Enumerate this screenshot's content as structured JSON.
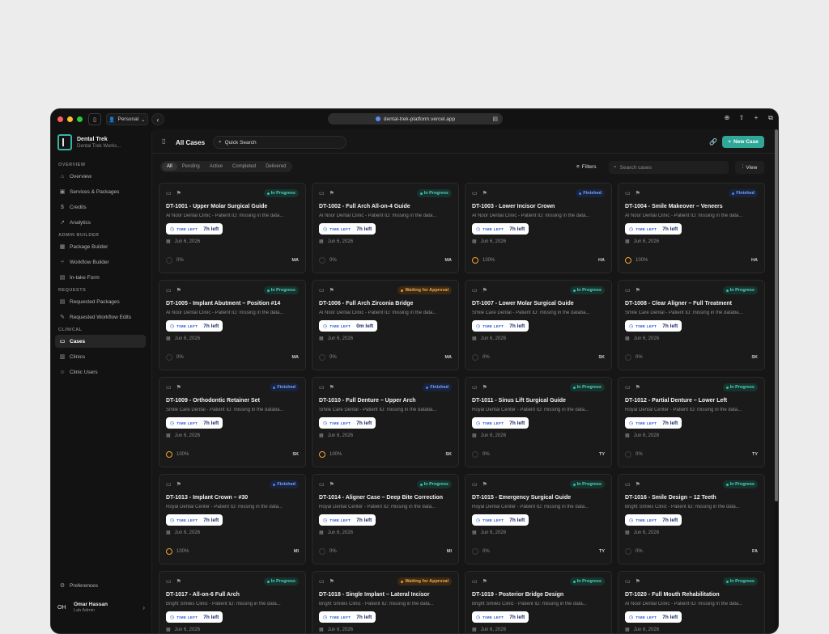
{
  "browser": {
    "profile": "Personal",
    "url": "dental-trek-platform.vercel.app"
  },
  "brand": {
    "name": "Dental Trek",
    "subtitle": "Dental Trek Works..."
  },
  "sidebar": {
    "sections": [
      {
        "label": "OVERVIEW",
        "items": [
          {
            "label": "Overview",
            "icon": "home-icon"
          },
          {
            "label": "Services & Packages",
            "icon": "package-icon"
          },
          {
            "label": "Credits",
            "icon": "dollar-icon"
          },
          {
            "label": "Analytics",
            "icon": "analytics-icon"
          }
        ]
      },
      {
        "label": "ADMIN BUILDER",
        "items": [
          {
            "label": "Package Builder",
            "icon": "builder-icon"
          },
          {
            "label": "Workflow Builder",
            "icon": "workflow-icon"
          },
          {
            "label": "In-take Form",
            "icon": "form-icon"
          }
        ]
      },
      {
        "label": "REQUESTS",
        "items": [
          {
            "label": "Requested Packages",
            "icon": "requests-icon"
          },
          {
            "label": "Requested Workflow Edits",
            "icon": "edit-icon"
          }
        ]
      },
      {
        "label": "CLINICAL",
        "items": [
          {
            "label": "Cases",
            "icon": "folder-icon",
            "active": true
          },
          {
            "label": "Clinics",
            "icon": "clinic-icon"
          },
          {
            "label": "Clinic Users",
            "icon": "users-icon"
          }
        ]
      }
    ],
    "preferences": "Preferences",
    "user": {
      "initials": "OH",
      "name": "Omar Hassan",
      "role": "Lab Admin"
    }
  },
  "header": {
    "title": "All Cases",
    "quick_search": "Quick Search",
    "new_case": "New Case"
  },
  "toolbar": {
    "tabs": [
      "All",
      "Pending",
      "Active",
      "Completed",
      "Delivered"
    ],
    "active_tab": "All",
    "filters": "Filters",
    "search_placeholder": "Search cases",
    "view": "View"
  },
  "time_left_label": "TIME LEFT",
  "status_colors": {
    "In Progress": {
      "bg": "#17332e",
      "fg": "#4fd1bd",
      "dot": "#2fbfa9"
    },
    "Finished": {
      "bg": "#18233d",
      "fg": "#7aa2ff",
      "dot": "#4f7df0"
    },
    "Waiting for Approval": {
      "bg": "#3a2a14",
      "fg": "#f0a64a",
      "dot": "#e89530"
    }
  },
  "cases": [
    {
      "title": "DT-1001 - Upper Molar Surgical Guide",
      "subtitle": "Al Noor Dental Clinic - Patient ID: missing in the data...",
      "status": "In Progress",
      "time_left": "7h left",
      "date": "Jun 6, 2026",
      "progress": "0%",
      "initials": "MA"
    },
    {
      "title": "DT-1002 - Full Arch All-on-4 Guide",
      "subtitle": "Al Noor Dental Clinic - Patient ID: missing in the data...",
      "status": "In Progress",
      "time_left": "7h left",
      "date": "Jun 6, 2026",
      "progress": "0%",
      "initials": "MA"
    },
    {
      "title": "DT-1003 - Lower Incisor Crown",
      "subtitle": "Al Noor Dental Clinic - Patient ID: missing in the data...",
      "status": "Finished",
      "time_left": "7h left",
      "date": "Jun 6, 2026",
      "progress": "100%",
      "initials": "HA"
    },
    {
      "title": "DT-1004 - Smile Makeover – Veneers",
      "subtitle": "Al Noor Dental Clinic - Patient ID: missing in the data...",
      "status": "Finished",
      "time_left": "7h left",
      "date": "Jun 6, 2026",
      "progress": "100%",
      "initials": "HA"
    },
    {
      "title": "DT-1005 - Implant Abutment – Position #14",
      "subtitle": "Al Noor Dental Clinic - Patient ID: missing in the data...",
      "status": "In Progress",
      "time_left": "7h left",
      "date": "Jun 6, 2026",
      "progress": "0%",
      "initials": "MA"
    },
    {
      "title": "DT-1006 - Full Arch Zirconia Bridge",
      "subtitle": "Al Noor Dental Clinic - Patient ID: missing in the data...",
      "status": "Waiting for Approval",
      "time_left": "0m left",
      "date": "Jun 6, 2026",
      "progress": "0%",
      "initials": "MA"
    },
    {
      "title": "DT-1007 - Lower Molar Surgical Guide",
      "subtitle": "Smile Care Dental - Patient ID: missing in the databa...",
      "status": "In Progress",
      "time_left": "7h left",
      "date": "Jun 6, 2026",
      "progress": "0%",
      "initials": "SK"
    },
    {
      "title": "DT-1008 - Clear Aligner – Full Treatment",
      "subtitle": "Smile Care Dental - Patient ID: missing in the databa...",
      "status": "In Progress",
      "time_left": "7h left",
      "date": "Jun 6, 2026",
      "progress": "0%",
      "initials": "SK"
    },
    {
      "title": "DT-1009 - Orthodontic Retainer Set",
      "subtitle": "Smile Care Dental - Patient ID: missing in the databa...",
      "status": "Finished",
      "time_left": "7h left",
      "date": "Jun 6, 2026",
      "progress": "100%",
      "initials": "SK"
    },
    {
      "title": "DT-1010 - Full Denture – Upper Arch",
      "subtitle": "Smile Care Dental - Patient ID: missing in the databa...",
      "status": "Finished",
      "time_left": "7h left",
      "date": "Jun 6, 2026",
      "progress": "100%",
      "initials": "SK"
    },
    {
      "title": "DT-1011 - Sinus Lift Surgical Guide",
      "subtitle": "Royal Dental Center - Patient ID: missing in the data...",
      "status": "In Progress",
      "time_left": "7h left",
      "date": "Jun 6, 2026",
      "progress": "0%",
      "initials": "TY"
    },
    {
      "title": "DT-1012 - Partial Denture – Lower Left",
      "subtitle": "Royal Dental Center - Patient ID: missing in the data...",
      "status": "In Progress",
      "time_left": "7h left",
      "date": "Jun 6, 2026",
      "progress": "0%",
      "initials": "TY"
    },
    {
      "title": "DT-1013 - Implant Crown – #30",
      "subtitle": "Royal Dental Center - Patient ID: missing in the data...",
      "status": "Finished",
      "time_left": "7h left",
      "date": "Jun 6, 2026",
      "progress": "100%",
      "initials": "MI"
    },
    {
      "title": "DT-1014 - Aligner Case – Deep Bite Correction",
      "subtitle": "Royal Dental Center - Patient ID: missing in the data...",
      "status": "In Progress",
      "time_left": "7h left",
      "date": "Jun 6, 2026",
      "progress": "0%",
      "initials": "MI"
    },
    {
      "title": "DT-1015 - Emergency Surgical Guide",
      "subtitle": "Royal Dental Center - Patient ID: missing in the data...",
      "status": "In Progress",
      "time_left": "7h left",
      "date": "Jun 6, 2026",
      "progress": "0%",
      "initials": "TY"
    },
    {
      "title": "DT-1016 - Smile Design – 12 Teeth",
      "subtitle": "Bright Smiles Clinic - Patient ID: missing in the data...",
      "status": "In Progress",
      "time_left": "7h left",
      "date": "Jun 6, 2026",
      "progress": "0%",
      "initials": "FA"
    },
    {
      "title": "DT-1017 - All-on-6 Full Arch",
      "subtitle": "Bright Smiles Clinic - Patient ID: missing in the data...",
      "status": "In Progress",
      "time_left": "7h left",
      "date": "Jun 6, 2026",
      "progress": "0%",
      "initials": ""
    },
    {
      "title": "DT-1018 - Single Implant – Lateral Incisor",
      "subtitle": "Bright Smiles Clinic - Patient ID: missing in the data...",
      "status": "Waiting for Approval",
      "time_left": "7h left",
      "date": "Jun 6, 2026",
      "progress": "0%",
      "initials": ""
    },
    {
      "title": "DT-1019 - Posterior Bridge Design",
      "subtitle": "Bright Smiles Clinic - Patient ID: missing in the data...",
      "status": "In Progress",
      "time_left": "7h left",
      "date": "Jun 6, 2026",
      "progress": "0%",
      "initials": ""
    },
    {
      "title": "DT-1020 - Full Mouth Rehabilitation",
      "subtitle": "Al Noor Dental Clinic - Patient ID: missing in the data...",
      "status": "In Progress",
      "time_left": "7h left",
      "date": "Jun 6, 2026",
      "progress": "0%",
      "initials": ""
    }
  ]
}
